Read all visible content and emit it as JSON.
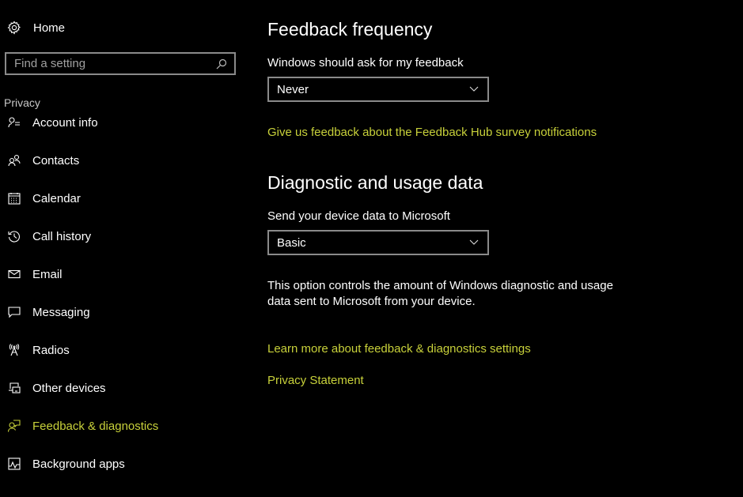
{
  "sidebar": {
    "home": {
      "label": "Home",
      "icon": "gear-icon"
    },
    "search": {
      "placeholder": "Find a setting",
      "value": "",
      "icon": "search-icon"
    },
    "section_label": "Privacy",
    "items": [
      {
        "label": "Account info",
        "icon": "account-info-icon",
        "active": false
      },
      {
        "label": "Contacts",
        "icon": "contacts-icon",
        "active": false
      },
      {
        "label": "Calendar",
        "icon": "calendar-icon",
        "active": false
      },
      {
        "label": "Call history",
        "icon": "call-history-icon",
        "active": false
      },
      {
        "label": "Email",
        "icon": "email-icon",
        "active": false
      },
      {
        "label": "Messaging",
        "icon": "messaging-icon",
        "active": false
      },
      {
        "label": "Radios",
        "icon": "radios-icon",
        "active": false
      },
      {
        "label": "Other devices",
        "icon": "other-devices-icon",
        "active": false
      },
      {
        "label": "Feedback & diagnostics",
        "icon": "feedback-icon",
        "active": true
      },
      {
        "label": "Background apps",
        "icon": "background-apps-icon",
        "active": false
      }
    ]
  },
  "main": {
    "feedback_frequency": {
      "title": "Feedback frequency",
      "field_label": "Windows should ask for my feedback",
      "selected": "Never",
      "link": "Give us feedback about the Feedback Hub survey notifications"
    },
    "diagnostic": {
      "title": "Diagnostic and usage data",
      "field_label": "Send your device data to Microsoft",
      "selected": "Basic",
      "description": "This option controls the amount of Windows diagnostic and usage data sent to Microsoft from your device.",
      "learn_more_link": "Learn more about feedback & diagnostics settings",
      "privacy_link": "Privacy Statement"
    }
  },
  "colors": {
    "accent": "#c8d13a",
    "background": "#000000",
    "border": "#8a8a8a"
  }
}
